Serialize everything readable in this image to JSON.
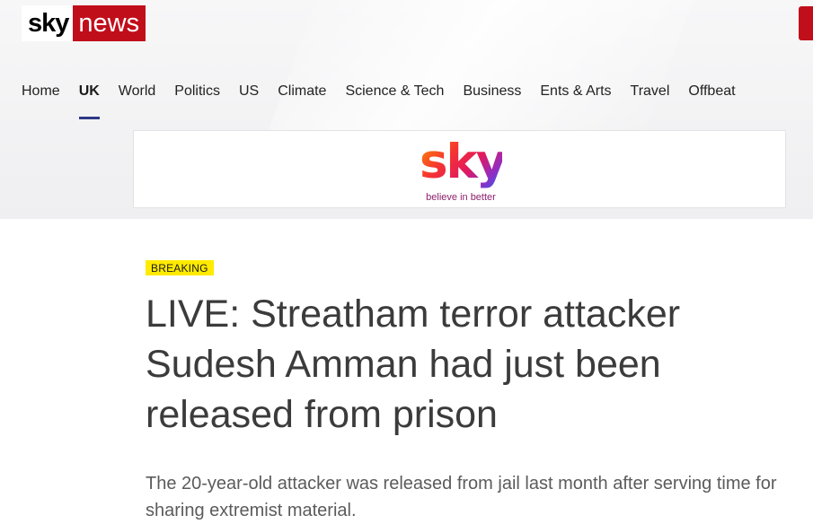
{
  "header": {
    "logo": {
      "sky": "sky",
      "news": "news"
    }
  },
  "nav": {
    "items": [
      {
        "label": "Home",
        "active": false
      },
      {
        "label": "UK",
        "active": true
      },
      {
        "label": "World",
        "active": false
      },
      {
        "label": "Politics",
        "active": false
      },
      {
        "label": "US",
        "active": false
      },
      {
        "label": "Climate",
        "active": false
      },
      {
        "label": "Science & Tech",
        "active": false
      },
      {
        "label": "Business",
        "active": false
      },
      {
        "label": "Ents & Arts",
        "active": false
      },
      {
        "label": "Travel",
        "active": false
      },
      {
        "label": "Offbeat",
        "active": false
      }
    ]
  },
  "advert": {
    "wordmark": "sky",
    "tagline": "believe in better"
  },
  "article": {
    "badge": "BREAKING",
    "headline": "LIVE: Streatham terror attacker Sudesh Amman had just been released from prison",
    "standfirst": "The 20-year-old attacker was released from jail last month after serving time for sharing extremist material."
  },
  "colors": {
    "brand_red": "#c10e1b",
    "active_underline": "#2e3a87",
    "breaking_badge": "#ffea00"
  }
}
